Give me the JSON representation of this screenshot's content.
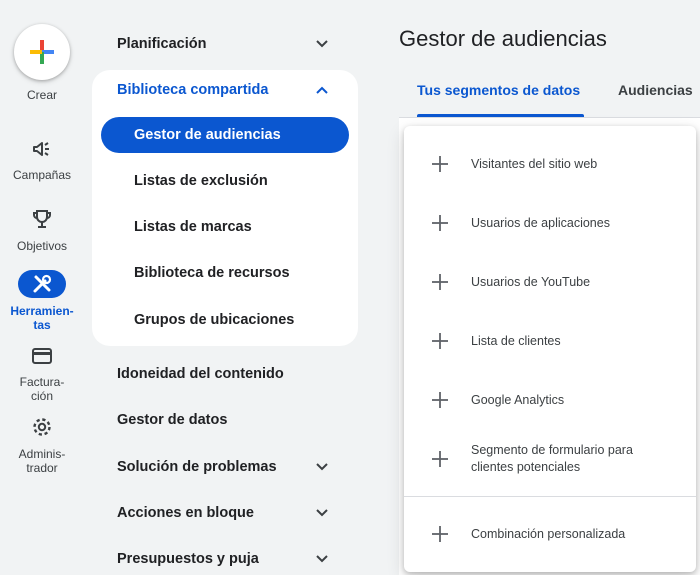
{
  "rail": {
    "create_label": "Crear",
    "items": [
      {
        "label": "Campañas",
        "icon": "megaphone-icon"
      },
      {
        "label": "Objetivos",
        "icon": "trophy-icon"
      },
      {
        "label": "Herramien-\ntas",
        "icon": "tools-icon",
        "active": true
      },
      {
        "label": "Factura-\nción",
        "icon": "credit-card-icon"
      },
      {
        "label": "Adminis-\ntrador",
        "icon": "gear-icon"
      }
    ]
  },
  "nav": {
    "planning": "Planificación",
    "shared_library": {
      "title": "Biblioteca compartida",
      "items": [
        "Gestor de audiencias",
        "Listas de exclusión",
        "Listas de marcas",
        "Biblioteca de recursos",
        "Grupos de ubicaciones"
      ]
    },
    "content_suitability": "Idoneidad del contenido",
    "data_manager": "Gestor de datos",
    "troubleshooting": "Solución de problemas",
    "bulk_actions": "Acciones en bloque",
    "budgets_bidding": "Presupuestos y puja"
  },
  "main": {
    "title": "Gestor de audiencias",
    "tabs": [
      "Tus segmentos de datos",
      "Audiencias"
    ]
  },
  "menu": {
    "items": [
      "Visitantes del sitio web",
      "Usuarios de aplicaciones",
      "Usuarios de YouTube",
      "Lista de clientes",
      "Google Analytics",
      "Segmento de formulario para\nclientes potenciales",
      "Combinación personalizada"
    ]
  },
  "colors": {
    "accent": "#0b57d0",
    "background": "#f1f3f4"
  }
}
